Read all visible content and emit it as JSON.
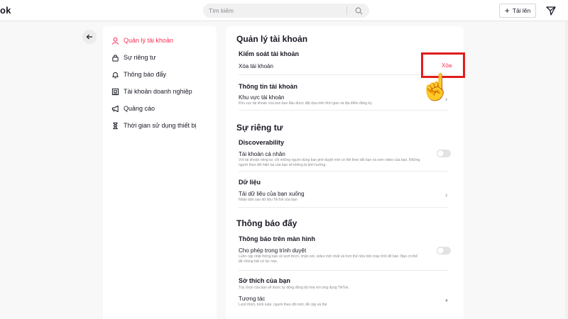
{
  "topbar": {
    "logo": "ok",
    "search_placeholder": "Tìm kiếm",
    "upload_label": "Tải lên",
    "upload_plus": "+"
  },
  "sidebar": {
    "items": [
      {
        "label": "Quản lý tài khoản",
        "icon": "user-icon",
        "active": true
      },
      {
        "label": "Sự riêng tư",
        "icon": "lock-icon",
        "active": false
      },
      {
        "label": "Thông báo đẩy",
        "icon": "bell-icon",
        "active": false
      },
      {
        "label": "Tài khoản doanh nghiệp",
        "icon": "business-icon",
        "active": false
      },
      {
        "label": "Quảng cáo",
        "icon": "megaphone-icon",
        "active": false
      },
      {
        "label": "Thời gian sử dụng thiết bị",
        "icon": "hourglass-icon",
        "active": false
      }
    ]
  },
  "main": {
    "account": {
      "title": "Quản lý tài khoản",
      "control_title": "Kiểm soát tài khoản",
      "delete_label": "Xóa tài khoản",
      "delete_action": "Xóa",
      "info_title": "Thông tin tài khoản",
      "region_label": "Khu vực tài khoản",
      "region_desc": "Khu vực tài khoản của bạn ban đầu được đặt dựa trên thời gian và địa điểm đăng ký."
    },
    "privacy": {
      "title": "Sự riêng tư",
      "discover_title": "Discoverability",
      "private_label": "Tài khoản cá nhân",
      "private_desc": "Với tài khoản riêng tư, chỉ những người dùng bạn phê duyệt mới có thể theo dõi bạn và xem video của bạn. Những người theo dõi hiện tại của bạn sẽ không bị ảnh hưởng.",
      "data_title": "Dữ liệu",
      "download_label": "Tải dữ liệu của bạn xuống",
      "download_desc": "Nhận bản sao dữ liệu TikTok của bạn"
    },
    "push": {
      "title": "Thông báo đẩy",
      "screen_title": "Thông báo trên màn hình",
      "browser_label": "Cho phép trong trình duyệt",
      "browser_desc": "Luôn cập nhật thông báo về lượt thích, nhận xét, video mới nhất và hơn thế nữa trên máy tính để bàn. Bạn có thể tắt chúng bất cứ lúc nào.",
      "prefs_title": "Sở thích của bạn",
      "prefs_desc": "Tùy chọn của bạn sẽ được tự động đồng bộ hóa với ứng dụng TikTok.",
      "interact_label": "Tương tác",
      "interact_desc": "Lượt thích, bình luận, người theo dõi mới, đề cập và thẻ"
    }
  },
  "colors": {
    "accent": "#fe2c55",
    "highlight": "#e11c1c"
  }
}
